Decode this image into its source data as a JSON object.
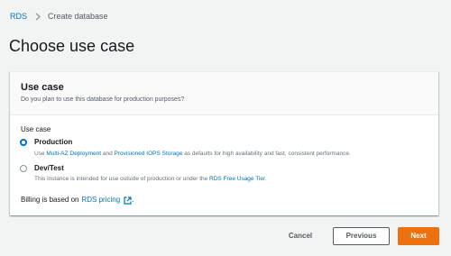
{
  "breadcrumb": {
    "items": [
      {
        "label": "RDS"
      },
      {
        "label": "Create database"
      }
    ]
  },
  "page": {
    "title": "Choose use case"
  },
  "use_case": {
    "title": "Use case",
    "description": "Do you plan to use this database for production purposes?",
    "field_label": "Use case",
    "options": [
      {
        "label": "Production",
        "selected": true,
        "desc_prefix": "Use ",
        "desc_link1": "Multi-AZ Deployment",
        "desc_mid": " and ",
        "desc_link2": "Provisioned IOPS Storage",
        "desc_suffix": " as defaults for high availability and fast, consistent performance."
      },
      {
        "label": "Dev/Test",
        "selected": false,
        "desc_prefix": "This instance is intended for use outside of production or under the ",
        "desc_link": "RDS Free Usage Tier",
        "desc_suffix": "."
      }
    ],
    "billing": {
      "prefix": "Billing is based on",
      "link": "RDS pricing",
      "suffix": "."
    }
  },
  "footer": {
    "cancel_label": "Cancel",
    "previous_label": "Previous",
    "next_label": "Next"
  },
  "colors": {
    "link": "#0073bb",
    "primary_button": "#ec7211",
    "background": "#f2f3f3"
  }
}
